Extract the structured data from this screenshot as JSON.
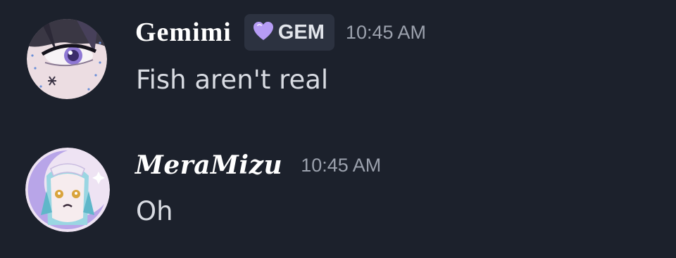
{
  "messages": [
    {
      "author": "Gemimi",
      "tag": {
        "label": "GEM",
        "icon": "purple-heart-icon",
        "color": "#b69cf5"
      },
      "timestamp": "10:45 AM",
      "content": "Fish aren't real"
    },
    {
      "author": "MeraMizu",
      "timestamp": "10:45 AM",
      "content": "Oh"
    }
  ],
  "colors": {
    "background": "#1c212c",
    "username": "#ffffff",
    "message_text": "#d8dbe2",
    "timestamp": "#9ba1ad",
    "tag_background": "#2c3240"
  }
}
